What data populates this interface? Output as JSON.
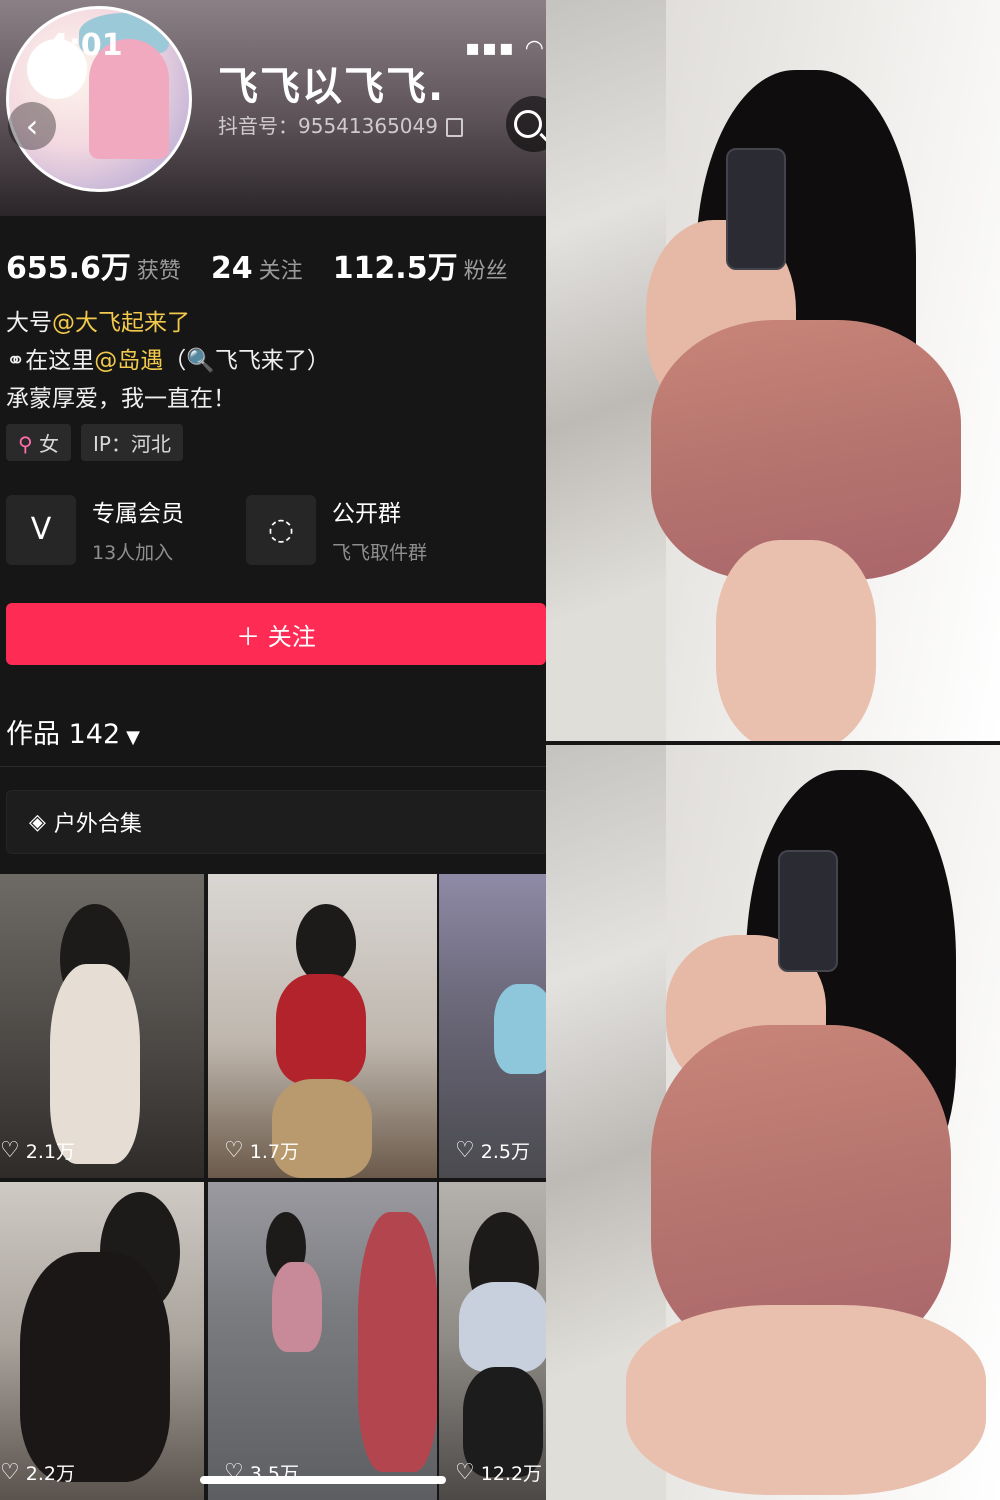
{
  "status_bar": {
    "time": "4:01",
    "icons": "▪▪▪ ◠"
  },
  "profile": {
    "name": "飞飞以飞飞.",
    "douyin_id": "抖音号：95541365049",
    "stats": [
      {
        "num": "655.6万",
        "label": "获赞"
      },
      {
        "num": "24",
        "label": "关注"
      },
      {
        "num": "112.5万",
        "label": "粉丝"
      }
    ],
    "bio": {
      "line1_prefix": "大号",
      "line1_mention": "@大飞起来了",
      "line2_prefix": "在这里",
      "line2_mention": "@岛遇",
      "line2_suffix": "（🔍飞飞来了）",
      "line3": "承蒙厚爱，我一直在！"
    },
    "tags": {
      "gender": "女",
      "ip": "IP：河北"
    },
    "features": [
      {
        "title": "专属会员",
        "sub": "13人加入"
      },
      {
        "title": "公开群",
        "sub": "飞飞取件群"
      }
    ],
    "follow_label": "＋ 关注",
    "works_label": "作品 142",
    "collection_label": "户外合集",
    "videos": [
      {
        "likes": "2.1万"
      },
      {
        "likes": "1.7万"
      },
      {
        "likes": "2.5万"
      },
      {
        "likes": "2.2万"
      },
      {
        "likes": "3.5万"
      },
      {
        "likes": "12.2万"
      }
    ]
  }
}
